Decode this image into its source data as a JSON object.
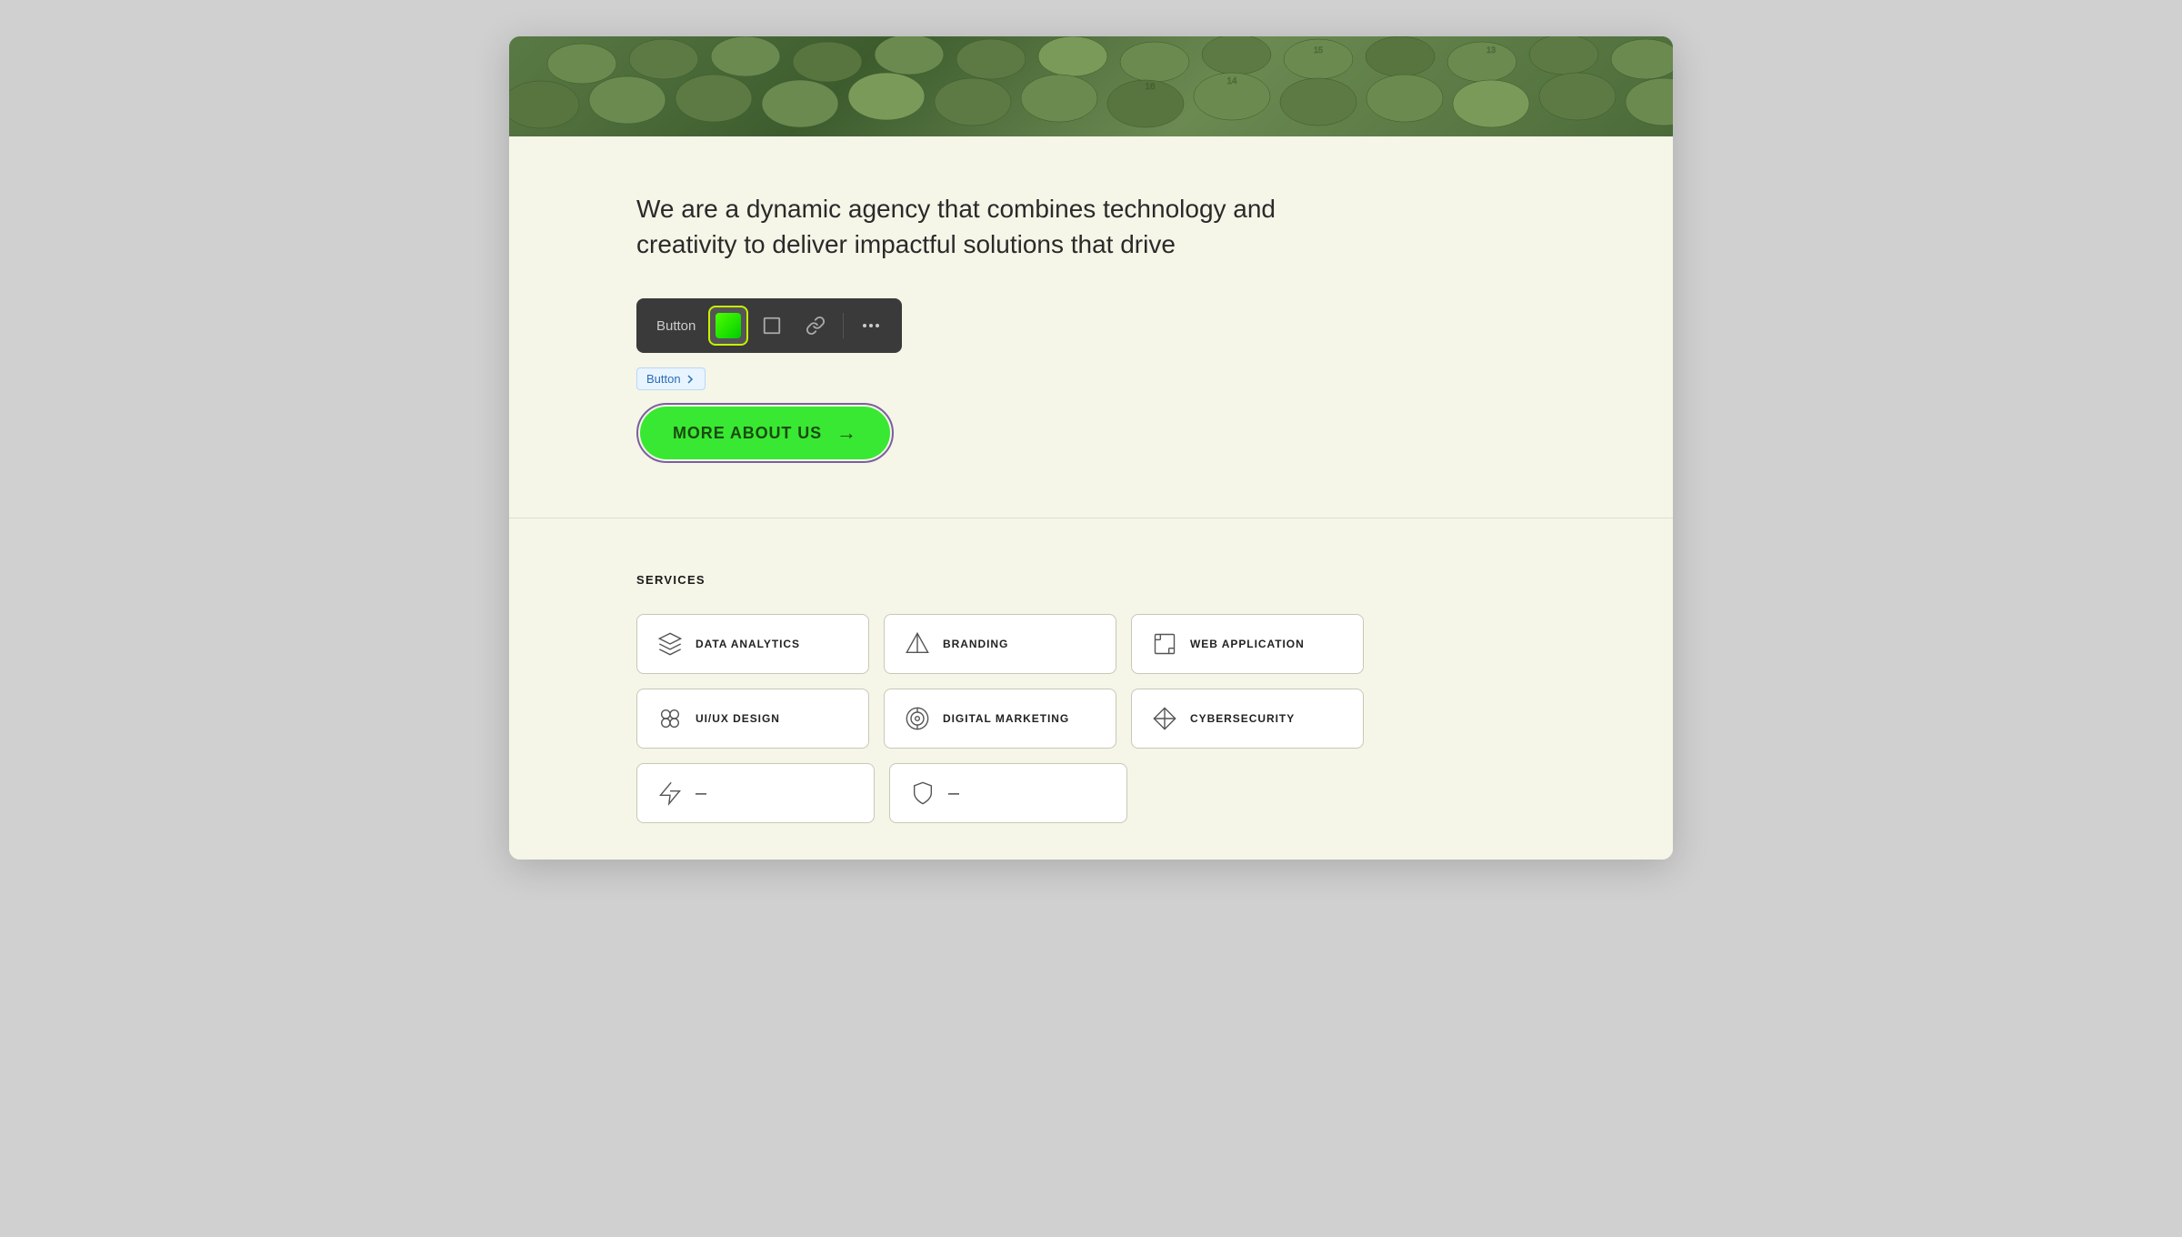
{
  "hero": {
    "alt": "Green stadium seats"
  },
  "about": {
    "text": "We are a dynamic agency that combines technology and creativity to deliver impactful solutions that drive",
    "toolbar": {
      "label": "Button",
      "buttons": [
        {
          "id": "color",
          "type": "color",
          "aria": "color-picker"
        },
        {
          "id": "resize",
          "type": "resize",
          "aria": "resize"
        },
        {
          "id": "link",
          "type": "link",
          "aria": "link"
        },
        {
          "id": "more",
          "type": "more",
          "aria": "more-options"
        }
      ]
    },
    "button_tag": "Button",
    "cta_label": "MORE ABOUT US",
    "cta_arrow": "→"
  },
  "services": {
    "heading": "SERVICES",
    "items": [
      {
        "id": "data-analytics",
        "name": "DATA ANALYTICS",
        "icon": "layers"
      },
      {
        "id": "branding",
        "name": "BRANDING",
        "icon": "triangle"
      },
      {
        "id": "web-application",
        "name": "WEB APPLICATION",
        "icon": "crop"
      },
      {
        "id": "ui-ux-design",
        "name": "UI/UX DESIGN",
        "icon": "circles"
      },
      {
        "id": "digital-marketing",
        "name": "DIGITAL MARKETING",
        "icon": "target"
      },
      {
        "id": "cybersecurity",
        "name": "CYBERSECURITY",
        "icon": "diamond"
      }
    ],
    "bottom_items": [
      {
        "id": "item7",
        "name": "...",
        "icon": "bolt"
      },
      {
        "id": "item8",
        "name": "...",
        "icon": "shield"
      }
    ]
  },
  "colors": {
    "accent_green": "#39e832",
    "bg_light": "#f5f5e8",
    "toolbar_bg": "#3a3a3a",
    "border_purple": "#7b5fa0",
    "tag_blue": "#2a6db5"
  }
}
